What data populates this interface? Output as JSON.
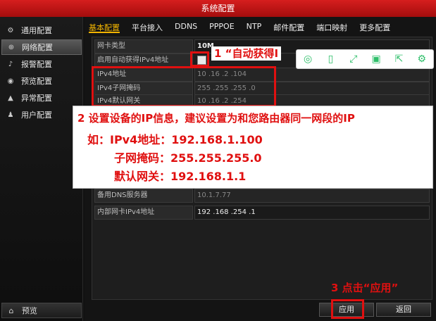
{
  "window": {
    "title": "系统配置"
  },
  "sidebar": {
    "items": [
      {
        "label": "通用配置",
        "icon": "gear-icon",
        "glyph": "⚙"
      },
      {
        "label": "网络配置",
        "icon": "network-icon",
        "glyph": "⊕"
      },
      {
        "label": "报警配置",
        "icon": "alarm-icon",
        "glyph": "♪"
      },
      {
        "label": "预览配置",
        "icon": "eye-icon",
        "glyph": "◉"
      },
      {
        "label": "异常配置",
        "icon": "warning-icon",
        "glyph": "▲"
      },
      {
        "label": "用户配置",
        "icon": "users-icon",
        "glyph": "♟"
      }
    ],
    "bottom": {
      "label": "预览",
      "icon": "home-icon",
      "glyph": "⌂"
    }
  },
  "tabs": [
    "基本配置",
    "平台接入",
    "DDNS",
    "PPPOE",
    "NTP",
    "邮件配置",
    "端口映射",
    "更多配置"
  ],
  "form": {
    "nic_type_label": "网卡类型",
    "nic_type_value": "10M",
    "dhcp_label": "启用自动获得IPv4地址",
    "ipv4_label": "IPv4地址",
    "ipv4_value": "10 .16 .2 .104",
    "mask_label": "IPv4子网掩码",
    "mask_value": "255 .255 .255 .0",
    "gateway_label": "IPv4默认网关",
    "gateway_value": "10 .16 .2 .254",
    "dns_label": "备用DNS服务器",
    "dns_value": "10.1.7.77",
    "internal_label": "内部网卡IPv4地址",
    "internal_value": "192 .168 .254 .1"
  },
  "annotations": {
    "step1": "1 “自动获得I",
    "step2_line1": "2 设置设备的IP信息，建议设置为和您路由器同一网段的IP",
    "step2_line2": "如：IPv4地址：192.168.1.100",
    "step2_line3": "子网掩码：255.255.255.0",
    "step2_line4": "默认网关：192.168.1.1",
    "step3": "3 点击“应用”"
  },
  "toolbar": [
    "search-icon",
    "phone-icon",
    "expand-icon",
    "save-icon",
    "share-icon",
    "settings-icon"
  ],
  "buttons": {
    "apply": "应用",
    "back": "返回"
  },
  "colors": {
    "accent": "#f2b400",
    "titlebar": "#c41414",
    "annotation": "#e01010",
    "toolbar_icon": "#2fbf6a"
  }
}
